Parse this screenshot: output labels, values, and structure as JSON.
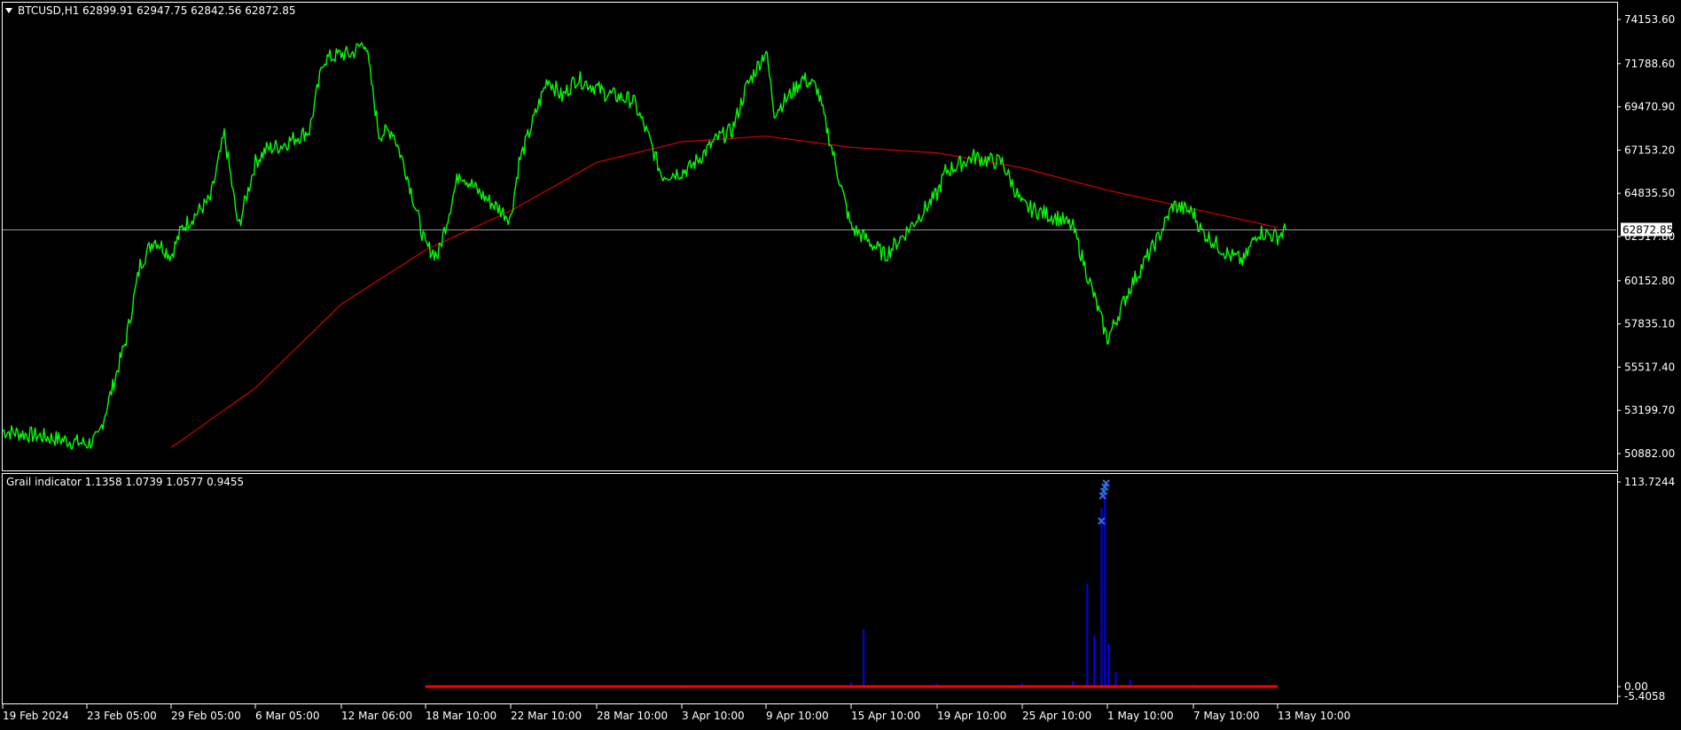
{
  "colors": {
    "background": "#000000",
    "frame": "#ffffff",
    "price_line": "#00ff00",
    "moving_average": "#d40000",
    "histogram": "#0000ff",
    "signal_marker": "#2f6fe0",
    "baseline": "#ff0000",
    "crosshair": "#9a9a9a",
    "price_tag_bg": "#ffffff",
    "price_tag_text": "#000000"
  },
  "main_panel": {
    "symbol_label": "BTCUSD,H1",
    "ohlc_label": "62899.91 62947.75 62842.56 62872.85",
    "collapse_icon": "triangle-down-icon",
    "current_price_tag": "62872.85"
  },
  "indicator_panel": {
    "header_label": "Grail indicator 1.1358 1.0739 1.0577 0.9455"
  },
  "chart_data": [
    {
      "type": "line",
      "panel": "main",
      "title": "",
      "ylim": [
        50882.0,
        74153.6
      ],
      "y_ticks": [
        "74153.60",
        "71788.60",
        "69470.90",
        "67153.20",
        "64835.50",
        "62517.80",
        "60152.80",
        "57835.10",
        "55517.40",
        "53199.70",
        "50882.00"
      ],
      "x_ticks": [
        "19 Feb 2024",
        "23 Feb 05:00",
        "29 Feb 05:00",
        "6 Mar 05:00",
        "12 Mar 06:00",
        "18 Mar 10:00",
        "22 Mar 10:00",
        "28 Mar 10:00",
        "3 Apr 10:00",
        "9 Apr 10:00",
        "15 Apr 10:00",
        "19 Apr 10:00",
        "25 Apr 10:00",
        "1 May 10:00",
        "7 May 10:00",
        "13 May 10:00"
      ],
      "current_price": 62872.85,
      "series": [
        {
          "role": "price",
          "x": [
            "19 Feb 2024",
            "21 Feb",
            "23 Feb 05:00",
            "24 Feb",
            "26 Feb",
            "27 Feb",
            "28 Feb",
            "29 Feb 05:00",
            "1 Mar",
            "3 Mar",
            "4 Mar",
            "5 Mar",
            "6 Mar 05:00",
            "7 Mar",
            "8 Mar",
            "10 Mar",
            "11 Mar",
            "12 Mar 06:00",
            "13 Mar",
            "14 Mar",
            "15 Mar",
            "16 Mar",
            "17 Mar",
            "18 Mar 10:00",
            "19 Mar",
            "20 Mar",
            "21 Mar",
            "22 Mar 10:00",
            "23 Mar",
            "25 Mar",
            "26 Mar",
            "27 Mar",
            "28 Mar 10:00",
            "29 Mar",
            "31 Mar",
            "1 Apr",
            "2 Apr",
            "3 Apr 10:00",
            "4 Apr",
            "6 Apr",
            "7 Apr",
            "8 Apr",
            "9 Apr 10:00",
            "10 Apr",
            "11 Apr",
            "12 Apr",
            "13 Apr",
            "15 Apr 10:00",
            "16 Apr",
            "17 Apr",
            "18 Apr",
            "19 Apr 10:00",
            "20 Apr",
            "22 Apr",
            "23 Apr",
            "24 Apr",
            "25 Apr 10:00",
            "26 Apr",
            "28 Apr",
            "29 Apr",
            "30 Apr",
            "1 May 10:00",
            "2 May",
            "3 May",
            "5 May",
            "6 May",
            "7 May 10:00",
            "8 May",
            "10 May",
            "11 May",
            "12 May",
            "13 May 10:00",
            "14 May"
          ],
          "values": [
            52100,
            51800,
            51400,
            51700,
            57000,
            61000,
            62400,
            61500,
            63000,
            64500,
            68000,
            63000,
            66500,
            67200,
            67400,
            68200,
            72000,
            72300,
            72300,
            73000,
            68000,
            68200,
            66000,
            62000,
            61500,
            66000,
            64800,
            63500,
            66500,
            71000,
            70000,
            71000,
            70500,
            70200,
            69800,
            68000,
            65800,
            66000,
            66200,
            67800,
            68200,
            70500,
            72500,
            69200,
            70000,
            71000,
            70500,
            63000,
            62500,
            61500,
            62800,
            64800,
            66000,
            66800,
            66600,
            66500,
            64200,
            64000,
            63500,
            63000,
            60500,
            57000,
            58000,
            59800,
            62500,
            64200,
            63800,
            62800,
            61500,
            61200,
            62800,
            62500,
            62872.85
          ]
        },
        {
          "role": "moving-average",
          "x": [
            "29 Feb 05:00",
            "6 Mar 05:00",
            "12 Mar 06:00",
            "18 Mar 10:00",
            "22 Mar 10:00",
            "28 Mar 10:00",
            "3 Apr 10:00",
            "9 Apr 10:00",
            "15 Apr 10:00",
            "19 Apr 10:00",
            "25 Apr 10:00",
            "1 May 10:00",
            "7 May 10:00",
            "13 May 10:00"
          ],
          "values": [
            51200,
            54400,
            58900,
            61800,
            63900,
            66500,
            67600,
            67900,
            67300,
            67000,
            66200,
            65000,
            64000,
            63000
          ]
        }
      ]
    },
    {
      "type": "bar",
      "panel": "indicator",
      "title": "",
      "ylim": [
        -5.4058,
        113.7244
      ],
      "y_ticks": [
        "113.7244",
        "0.00",
        "-5.4058"
      ],
      "series": [
        {
          "role": "histogram",
          "x": [
            "18 Mar 10:00",
            "3 Apr 10:00",
            "15 Apr 10:00",
            "16 Apr",
            "19 Apr 10:00",
            "25 Apr 10:00",
            "29 Apr",
            "30 Apr",
            "30 Apr 12:00",
            "1 May",
            "1 May 06:00",
            "1 May 12:00",
            "2 May",
            "3 May",
            "7 May 10:00",
            "13 May 10:00"
          ],
          "values": [
            0.8,
            1.0,
            2.5,
            32.0,
            1.5,
            1.8,
            3.0,
            57.0,
            28.0,
            99.0,
            108.0,
            24.0,
            8.0,
            4.0,
            1.2,
            0.8
          ]
        },
        {
          "role": "signal-markers",
          "x": [
            "1 May",
            "1 May 02:00",
            "1 May 04:00",
            "1 May 06:00",
            "1 May 08:00"
          ],
          "values": [
            92.0,
            106.0,
            108.5,
            111.0,
            113.0
          ]
        },
        {
          "role": "baseline",
          "x": [
            "18 Mar 10:00",
            "13 May 10:00"
          ],
          "values": [
            0.0,
            0.0
          ]
        }
      ]
    }
  ]
}
